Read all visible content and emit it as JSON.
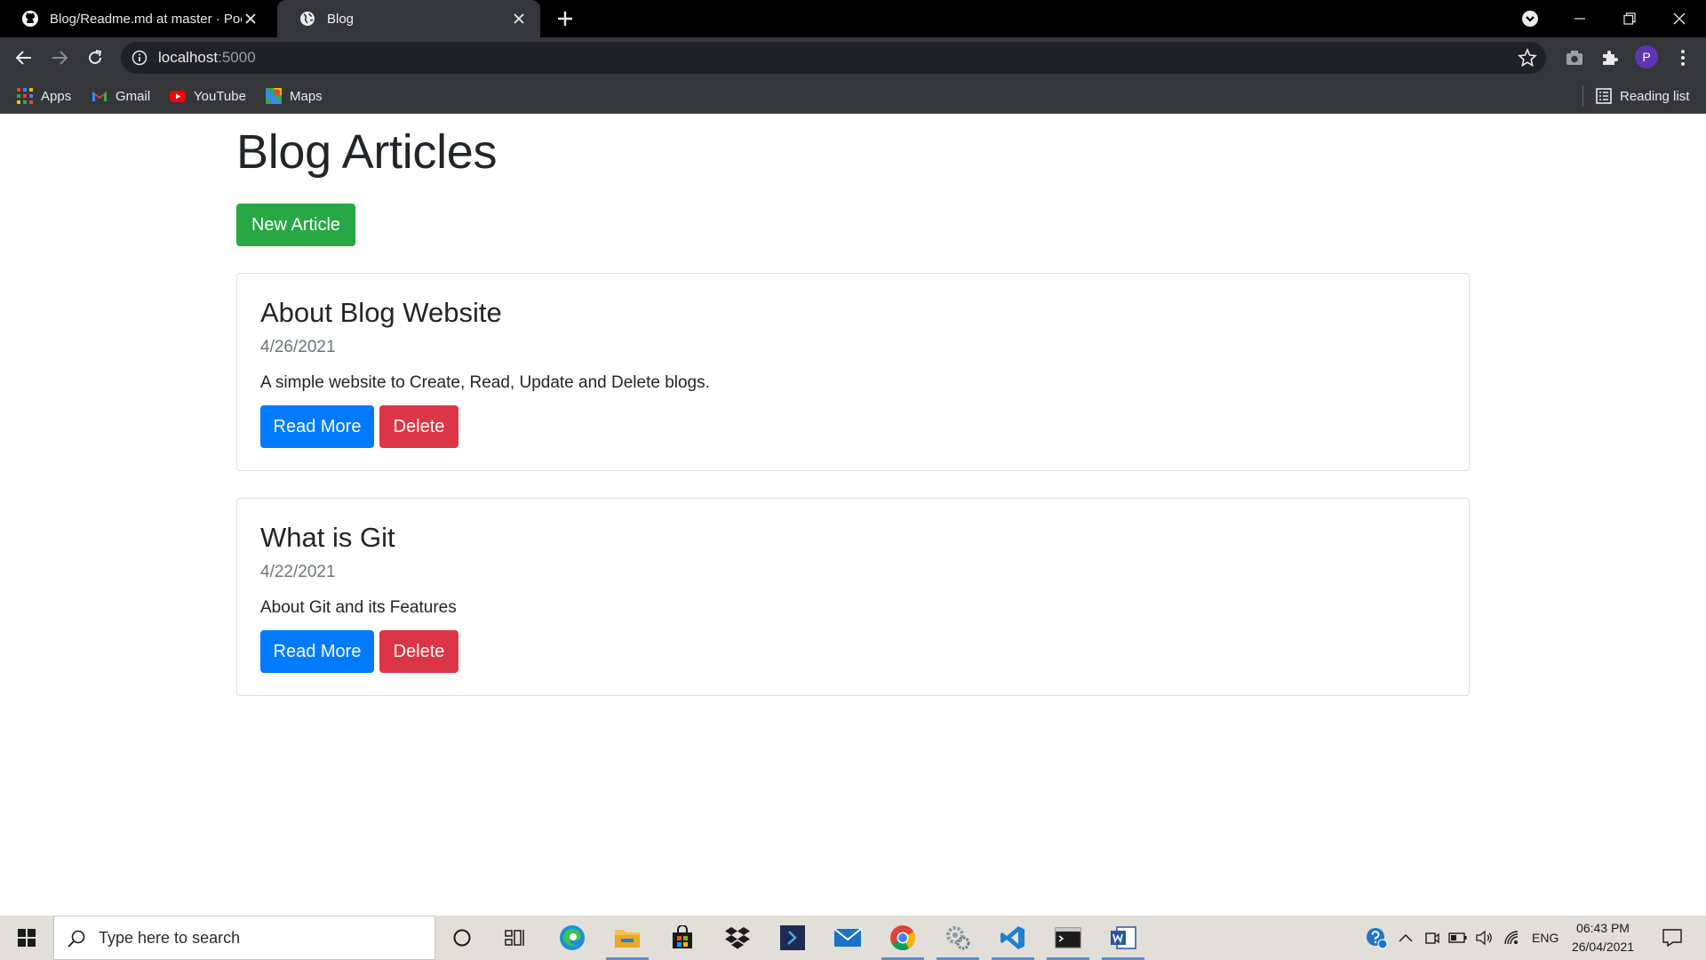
{
  "browser": {
    "tabs": [
      {
        "title": "Blog/Readme.md at master · Poo",
        "icon": "github-icon",
        "active": false
      },
      {
        "title": "Blog",
        "icon": "globe-icon",
        "active": true
      }
    ],
    "url": {
      "host": "localhost",
      "port": ":5000"
    },
    "bookmarks": [
      {
        "label": "Apps",
        "icon": "apps-grid-icon"
      },
      {
        "label": "Gmail",
        "icon": "gmail-icon"
      },
      {
        "label": "YouTube",
        "icon": "youtube-icon"
      },
      {
        "label": "Maps",
        "icon": "maps-icon"
      }
    ],
    "reading_list": "Reading list",
    "profile_initial": "P"
  },
  "page": {
    "title": "Blog Articles",
    "new_article_label": "New Article",
    "articles": [
      {
        "title": "About Blog Website",
        "date": "4/26/2021",
        "description": "A simple website to Create, Read, Update and Delete blogs.",
        "read_more_label": "Read More",
        "delete_label": "Delete"
      },
      {
        "title": "What is Git",
        "date": "4/22/2021",
        "description": "About Git and its Features",
        "read_more_label": "Read More",
        "delete_label": "Delete"
      }
    ]
  },
  "taskbar": {
    "search_placeholder": "Type here to search",
    "language": "ENG",
    "time": "06:43 PM",
    "date": "26/04/2021"
  },
  "colors": {
    "success": "#28a745",
    "primary": "#007bff",
    "danger": "#dc3545",
    "browser_dark": "#35363a"
  }
}
